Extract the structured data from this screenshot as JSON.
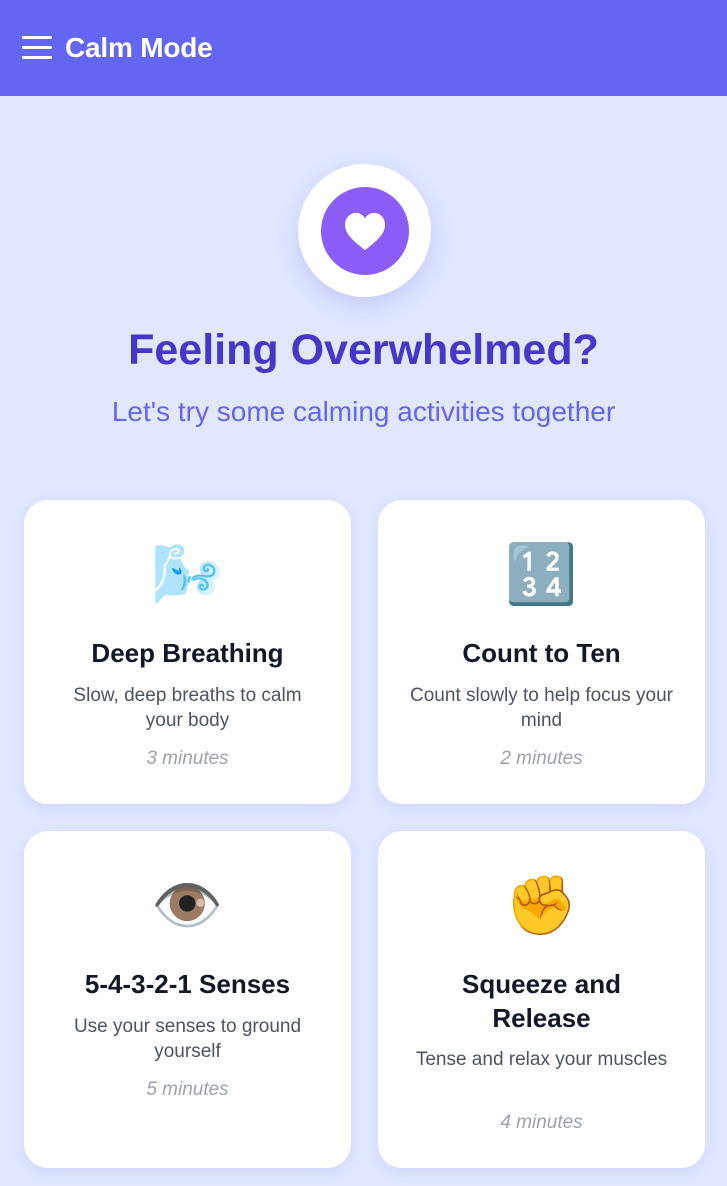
{
  "app": {
    "title": "Calm Mode"
  },
  "hero": {
    "icon": "heart-icon",
    "title": "Feeling Overwhelmed?",
    "subtitle": "Let's try some calming activities together"
  },
  "colors": {
    "header": "#6366f1",
    "background": "#e0e7ff",
    "title": "#4338ca",
    "heart_disc": "#8b5cf6"
  },
  "activities": [
    {
      "emoji": "🌬️",
      "title": "Deep Breathing",
      "description": "Slow, deep breaths to calm your body",
      "duration": "3 minutes"
    },
    {
      "emoji": "🔢",
      "title": "Count to Ten",
      "description": "Count slowly to help focus your mind",
      "duration": "2 minutes"
    },
    {
      "emoji": "👁️",
      "title": "5-4-3-2-1 Senses",
      "description": "Use your senses to ground yourself",
      "duration": "5 minutes"
    },
    {
      "emoji": "✊",
      "title": "Squeeze and Release",
      "description": "Tense and relax your muscles",
      "duration": "4 minutes"
    }
  ]
}
